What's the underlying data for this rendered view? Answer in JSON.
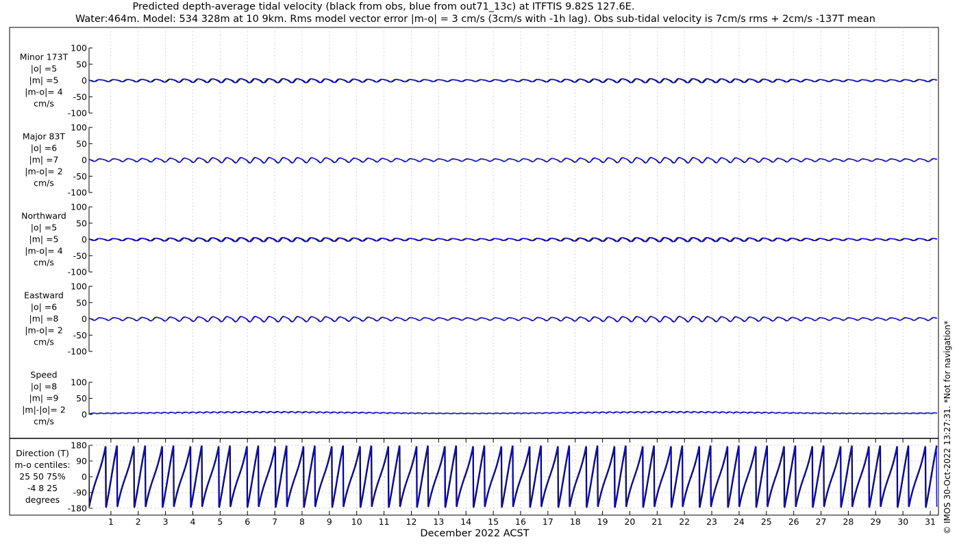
{
  "title_line1": "Predicted depth-average tidal velocity (black from obs, blue from out71_13c) at ITFTIS 9.82S 127.6E.",
  "title_line2": "Water:464m. Model: 534 328m at 10 9km. Rms model vector error |m-o| = 3 cm/s (3cm/s with -1h lag). Obs sub-tidal velocity is 7cm/s rms + 2cm/s -137T mean",
  "xlabel": "December 2022 ACST",
  "copyright": "© IMOS 30-Oct-2022 13:27:31. *Not for navigation*",
  "colors": {
    "obs": "#000000",
    "model": "#1010d0"
  },
  "chart_data": [
    {
      "type": "line",
      "panel": "minor",
      "label_lines": [
        "Minor 173T",
        "|o| =5",
        "|m| =5",
        "|m-o|= 4",
        "cm/s"
      ],
      "yticks": [
        "100",
        "50",
        "0",
        "-50",
        "-100"
      ],
      "ylim": [
        -100,
        100
      ],
      "series": [
        {
          "color": "#000000",
          "amplitude": 6,
          "phase": 0.0
        },
        {
          "color": "#1010d0",
          "amplitude": 6,
          "phase": 0.5
        }
      ]
    },
    {
      "type": "line",
      "panel": "major",
      "label_lines": [
        "Major 83T",
        "|o| =6",
        "|m| =7",
        "|m-o|= 2",
        "cm/s"
      ],
      "yticks": [
        "100",
        "50",
        "0",
        "-50",
        "-100"
      ],
      "ylim": [
        -100,
        100
      ],
      "series": [
        {
          "color": "#000000",
          "amplitude": 7,
          "phase": 0.0
        },
        {
          "color": "#1010d0",
          "amplitude": 8,
          "phase": 0.2
        }
      ]
    },
    {
      "type": "line",
      "panel": "northward",
      "label_lines": [
        "Northward",
        "|o| =5",
        "|m| =5",
        "|m-o|= 4",
        "cm/s"
      ],
      "yticks": [
        "100",
        "50",
        "0",
        "-50",
        "-100"
      ],
      "ylim": [
        -100,
        100
      ],
      "series": [
        {
          "color": "#000000",
          "amplitude": 6,
          "phase": 0.0
        },
        {
          "color": "#1010d0",
          "amplitude": 6,
          "phase": 0.6
        }
      ]
    },
    {
      "type": "line",
      "panel": "eastward",
      "label_lines": [
        "Eastward",
        "|o| =6",
        "|m| =8",
        "|m-o|= 2",
        "cm/s"
      ],
      "yticks": [
        "100",
        "50",
        "0",
        "-50",
        "-100"
      ],
      "ylim": [
        -100,
        100
      ],
      "series": [
        {
          "color": "#000000",
          "amplitude": 7,
          "phase": 0.0
        },
        {
          "color": "#1010d0",
          "amplitude": 8,
          "phase": 0.2
        }
      ]
    },
    {
      "type": "line",
      "panel": "speed",
      "label_lines": [
        "Speed",
        "|o| =8",
        "|m| =9",
        "|m|-|o|= 2",
        "cm/s"
      ],
      "yticks": [
        "100",
        "50",
        "0"
      ],
      "ylim": [
        0,
        100
      ],
      "series": [
        {
          "color": "#000000",
          "amplitude": 8,
          "phase": 0.0
        },
        {
          "color": "#1010d0",
          "amplitude": 9,
          "phase": 0.3
        }
      ]
    },
    {
      "type": "line",
      "panel": "direction",
      "label_lines": [
        "Direction (T)",
        "m-o centiles:",
        "25  50  75%",
        "-4   8  25",
        "degrees"
      ],
      "yticks": [
        "180",
        "90",
        "0",
        "-90",
        "-180"
      ],
      "ylim": [
        -180,
        180
      ],
      "series": [
        {
          "color": "#000000",
          "phase": 0.0
        },
        {
          "color": "#1010d0",
          "phase": 0.35
        }
      ]
    }
  ],
  "x_axis": {
    "unit": "day of December 2022",
    "xlim": [
      0.2,
      31.25
    ],
    "ticks": [
      "1",
      "2",
      "3",
      "4",
      "5",
      "6",
      "7",
      "8",
      "9",
      "10",
      "11",
      "12",
      "13",
      "14",
      "15",
      "16",
      "17",
      "18",
      "19",
      "20",
      "21",
      "22",
      "23",
      "24",
      "25",
      "26",
      "27",
      "28",
      "29",
      "30",
      "31"
    ]
  }
}
